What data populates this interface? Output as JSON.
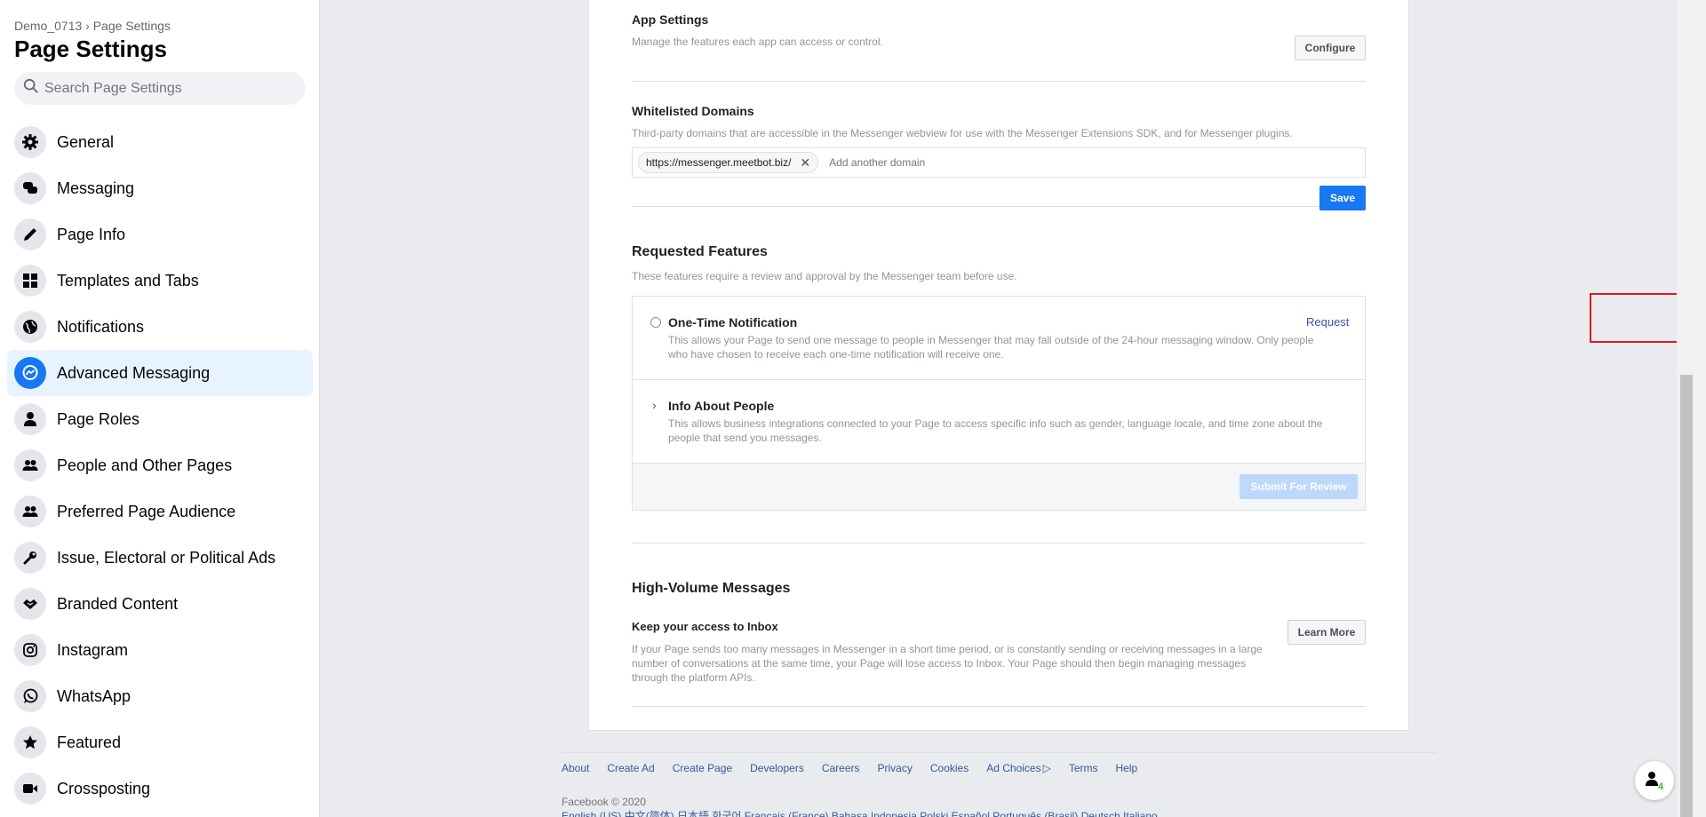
{
  "sidebar": {
    "breadcrumb": "Demo_0713 › Page Settings",
    "title": "Page Settings",
    "search_placeholder": "Search Page Settings",
    "items": [
      {
        "label": "General",
        "icon": "gear-icon"
      },
      {
        "label": "Messaging",
        "icon": "chat-bubbles-icon"
      },
      {
        "label": "Page Info",
        "icon": "pencil-icon"
      },
      {
        "label": "Templates and Tabs",
        "icon": "grid-icon"
      },
      {
        "label": "Notifications",
        "icon": "globe-icon"
      },
      {
        "label": "Advanced Messaging",
        "icon": "messenger-icon",
        "active": true
      },
      {
        "label": "Page Roles",
        "icon": "person-icon"
      },
      {
        "label": "People and Other Pages",
        "icon": "people-icon"
      },
      {
        "label": "Preferred Page Audience",
        "icon": "people-icon"
      },
      {
        "label": "Issue, Electoral or Political Ads",
        "icon": "wrench-icon"
      },
      {
        "label": "Branded Content",
        "icon": "handshake-icon"
      },
      {
        "label": "Instagram",
        "icon": "instagram-icon"
      },
      {
        "label": "WhatsApp",
        "icon": "whatsapp-icon"
      },
      {
        "label": "Featured",
        "icon": "star-icon"
      },
      {
        "label": "Crossposting",
        "icon": "video-camera-icon"
      }
    ]
  },
  "app_settings": {
    "title": "App Settings",
    "description": "Manage the features each app can access or control.",
    "button": "Configure"
  },
  "whitelisted": {
    "title": "Whitelisted Domains",
    "description": "Third-party domains that are accessible in the Messenger webview for use with the Messenger Extensions SDK, and for Messenger plugins.",
    "domain": "https://messenger.meetbot.biz/",
    "placeholder": "Add another domain",
    "save": "Save"
  },
  "requested": {
    "title": "Requested Features",
    "description": "These features require a review and approval by the Messenger team before use.",
    "features": [
      {
        "title": "One-Time Notification",
        "description": "This allows your Page to send one message to people in Messenger that may fall outside of the 24-hour messaging window. Only people who have chosen to receive each one-time notification will receive one.",
        "action": "Request"
      },
      {
        "title": "Info About People",
        "description": "This allows business integrations connected to your Page to access specific info such as gender, language locale, and time zone about the people that send you messages."
      }
    ],
    "submit": "Submit For Review"
  },
  "high_volume": {
    "title": "High-Volume Messages",
    "subtitle": "Keep your access to Inbox",
    "description": "If your Page sends too many messages in Messenger in a short time period, or is constantly sending or receiving messages in a large number of conversations at the same time, your Page will lose access to Inbox. Your Page should then begin managing messages through the platform APIs.",
    "button": "Learn More"
  },
  "footer": {
    "links": [
      "About",
      "Create Ad",
      "Create Page",
      "Developers",
      "Careers",
      "Privacy",
      "Cookies",
      "Ad Choices",
      "Terms",
      "Help"
    ],
    "copyright": "Facebook © 2020",
    "languages": "English (US)   中文(简体)   日本語   한국어   Français (France)   Bahasa Indonesia   Polski   Español   Português (Brasil)   Deutsch   Italiano"
  },
  "floating_badge": "4",
  "colors": {
    "accent": "#1877f2",
    "highlight": "#e01b1b"
  }
}
